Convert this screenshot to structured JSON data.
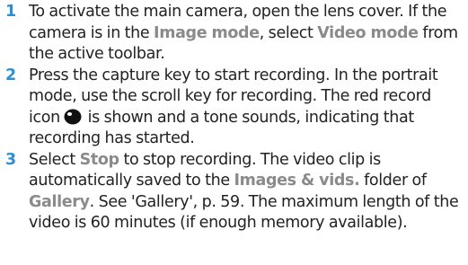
{
  "steps": [
    {
      "number": "1",
      "parts": [
        {
          "text": "To activate the main camera, open the lens cover. If the camera is in the ",
          "hl": false
        },
        {
          "text": "Image mode",
          "hl": true
        },
        {
          "text": ", select ",
          "hl": false
        },
        {
          "text": "Video mode",
          "hl": true
        },
        {
          "text": " from the active toolbar.",
          "hl": false
        }
      ]
    },
    {
      "number": "2",
      "parts": [
        {
          "text": "Press the capture key to start recording. In the portrait mode, use the scroll key for recording. The red record icon",
          "hl": false
        },
        {
          "icon": "record-icon"
        },
        {
          "text": " is shown and a tone sounds, indicating that recording has started.",
          "hl": false
        }
      ]
    },
    {
      "number": "3",
      "parts": [
        {
          "text": "Select ",
          "hl": false
        },
        {
          "text": "Stop",
          "hl": true
        },
        {
          "text": " to stop recording. The video clip is automatically saved to the ",
          "hl": false
        },
        {
          "text": "Images & vids.",
          "hl": true
        },
        {
          "text": " folder of ",
          "hl": false
        },
        {
          "text": "Gallery",
          "hl": true
        },
        {
          "text": ". See 'Gallery', p. 59. The maximum length of the video is 60 minutes (if enough memory available).",
          "hl": false
        }
      ]
    }
  ],
  "colors": {
    "step_number": "#2b8fd6",
    "highlight": "#8a8a8a",
    "body_text": "#222222",
    "record_icon": "#111111"
  }
}
